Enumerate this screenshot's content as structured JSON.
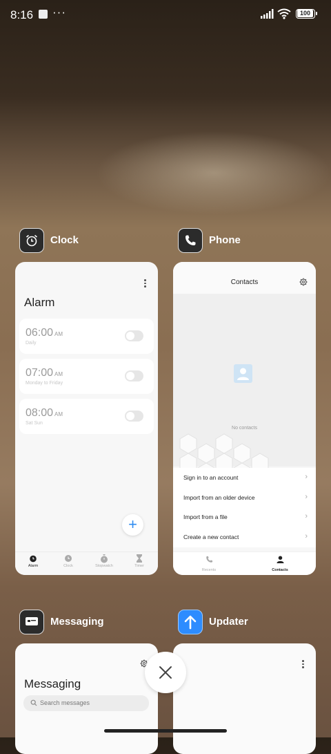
{
  "status_bar": {
    "time": "8:16",
    "battery": "100"
  },
  "apps": {
    "clock": {
      "name": "Clock",
      "title": "Alarm",
      "alarms": [
        {
          "time": "06:00",
          "ampm": "AM",
          "repeat": "Daily"
        },
        {
          "time": "07:00",
          "ampm": "AM",
          "repeat": "Monday to Friday"
        },
        {
          "time": "08:00",
          "ampm": "AM",
          "repeat": "Sat Sun"
        }
      ],
      "fab": "+",
      "tabs": [
        "Alarm",
        "Clock",
        "Stopwatch",
        "Timer"
      ]
    },
    "phone": {
      "name": "Phone",
      "title": "Contacts",
      "empty_text": "No contacts",
      "menu": [
        "Sign in to an account",
        "Import from an older device",
        "Import from a file",
        "Create a new contact"
      ],
      "tabs": [
        "Recents",
        "Contacts"
      ]
    },
    "messaging": {
      "name": "Messaging",
      "title": "Messaging",
      "search_placeholder": "Search messages"
    },
    "updater": {
      "name": "Updater"
    }
  },
  "colors": {
    "accent": "#2f8cf0",
    "updater_icon": "#2d8cff"
  },
  "icons": {
    "close": "close-icon"
  }
}
